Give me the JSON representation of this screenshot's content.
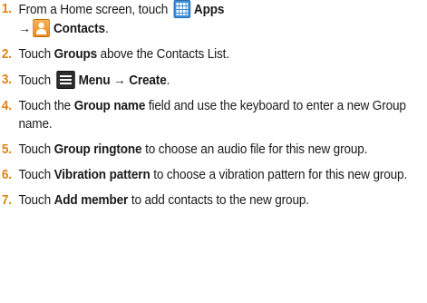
{
  "steps": [
    {
      "num": "1.",
      "t1": "From a Home screen, touch ",
      "apps_icon": "apps-grid-icon",
      "apps": "Apps",
      "arrow": "→",
      "contacts_icon": "contacts-person-icon",
      "contacts": "Contacts",
      "end": "."
    },
    {
      "num": "2.",
      "t1": "Touch ",
      "b1": "Groups",
      "t2": " above the Contacts List."
    },
    {
      "num": "3.",
      "t1": "Touch ",
      "menu_icon": "menu-icon",
      "b1": "Menu",
      "arrow": "→",
      "b2": "Create",
      "end": "."
    },
    {
      "num": "4.",
      "t1": "Touch the ",
      "b1": "Group name",
      "t2": " field and use the keyboard to enter a new Group name."
    },
    {
      "num": "5.",
      "t1": "Touch ",
      "b1": "Group ringtone",
      "t2": " to choose an audio file for this new group."
    },
    {
      "num": "6.",
      "t1": "Touch ",
      "b1": "Vibration pattern",
      "t2": " to choose a vibration pattern for this new group."
    },
    {
      "num": "7.",
      "t1": "Touch ",
      "b1": "Add member",
      "t2": " to add contacts to the new group."
    }
  ],
  "colors": {
    "step_number": "#e0820f",
    "apps_icon": "#3a8fd8",
    "contacts_icon": "#e98a18",
    "menu_icon": "#2c2c2c"
  }
}
